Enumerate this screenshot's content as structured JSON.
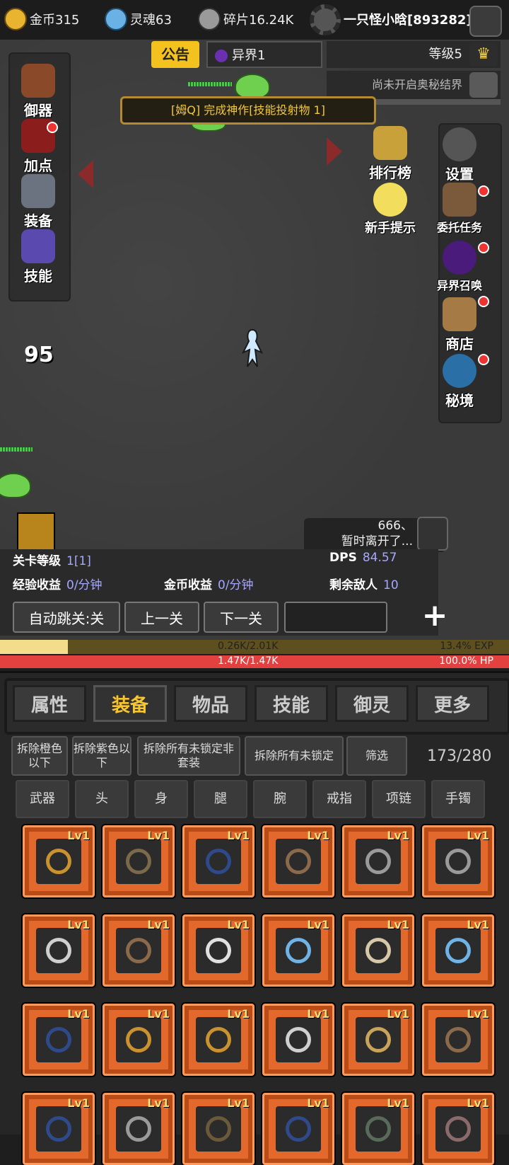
{
  "resources": {
    "gold": "金币315",
    "soul": "灵魂63",
    "fragments": "碎片16.24K"
  },
  "player": {
    "name": "一只怪小晗[893282]",
    "level": "等级5"
  },
  "header": {
    "notice_tab": "公告",
    "realm_tab": "异界1",
    "mystic_status": "尚未开启奥秘结界",
    "quest_banner": "[姆Q] 完成神作[技能投射物 1]"
  },
  "left_menu": [
    {
      "label": "御器"
    },
    {
      "label": "加点"
    },
    {
      "label": "装备"
    },
    {
      "label": "技能"
    }
  ],
  "right_menu": [
    {
      "label": "排行榜"
    },
    {
      "label": "设置"
    },
    {
      "label": "新手提示"
    },
    {
      "label": "委托任务"
    },
    {
      "label": "异界召唤"
    },
    {
      "label": "商店"
    },
    {
      "label": "秘境"
    }
  ],
  "scene": {
    "damage_number": "95",
    "chat_line1": "666、",
    "chat_line2": "暂时离开了..."
  },
  "stats": {
    "stage_level_label": "关卡等级",
    "stage_level_value": "1[1]",
    "dps_label": "DPS",
    "dps_value": "84.57",
    "exp_income_label": "经验收益",
    "exp_income_value": "0/分钟",
    "gold_income_label": "金币收益",
    "gold_income_value": "0/分钟",
    "enemies_label": "剩余敌人",
    "enemies_value": "10"
  },
  "controls": {
    "auto_skip": "自动跳关:关",
    "prev": "上一关",
    "next": "下一关",
    "plus": "+"
  },
  "bars": {
    "exp_text": "0.26K/2.01K",
    "exp_percent": "13.4%  EXP",
    "exp_fraction": 0.134,
    "hp_text": "1.47K/1.47K",
    "hp_percent": "100.0%  HP",
    "hp_fraction": 1.0
  },
  "tabs": [
    {
      "label": "属性"
    },
    {
      "label": "装备"
    },
    {
      "label": "物品"
    },
    {
      "label": "技能"
    },
    {
      "label": "御灵"
    },
    {
      "label": "更多"
    }
  ],
  "actions": {
    "remove_orange": "拆除橙色以下",
    "remove_purple": "拆除紫色以下",
    "remove_unlocked_nonset": "拆除所有未锁定非套装",
    "remove_all_unlocked": "拆除所有未锁定",
    "filter": "筛选",
    "count": "173/280"
  },
  "filters": [
    "武器",
    "头",
    "身",
    "腿",
    "腕",
    "戒指",
    "项链",
    "手镯"
  ],
  "inventory": [
    {
      "lv": "Lv1",
      "icon": "ring-icon"
    },
    {
      "lv": "Lv1",
      "icon": "necklace-icon"
    },
    {
      "lv": "Lv1",
      "icon": "boot-icon"
    },
    {
      "lv": "Lv1",
      "icon": "amulet-icon"
    },
    {
      "lv": "Lv1",
      "icon": "helmet-icon"
    },
    {
      "lv": "Lv1",
      "icon": "helmet-icon"
    },
    {
      "lv": "Lv1",
      "icon": "sword-icon"
    },
    {
      "lv": "Lv1",
      "icon": "amulet-icon"
    },
    {
      "lv": "Lv1",
      "icon": "saber-icon"
    },
    {
      "lv": "Lv1",
      "icon": "bracelet-icon"
    },
    {
      "lv": "Lv1",
      "icon": "hat-icon"
    },
    {
      "lv": "Lv1",
      "icon": "bracelet-icon"
    },
    {
      "lv": "Lv1",
      "icon": "boot-icon"
    },
    {
      "lv": "Lv1",
      "icon": "ring-icon"
    },
    {
      "lv": "Lv1",
      "icon": "ring-icon"
    },
    {
      "lv": "Lv1",
      "icon": "blade-icon"
    },
    {
      "lv": "Lv1",
      "icon": "spartan-helmet-icon"
    },
    {
      "lv": "Lv1",
      "icon": "amulet-icon"
    },
    {
      "lv": "Lv1",
      "icon": "boot-icon"
    },
    {
      "lv": "Lv1",
      "icon": "bow-icon"
    },
    {
      "lv": "Lv1",
      "icon": "crossbow-icon"
    },
    {
      "lv": "Lv1",
      "icon": "boot-icon"
    },
    {
      "lv": "Lv1",
      "icon": "twin-swords-icon"
    },
    {
      "lv": "Lv1",
      "icon": "hammer-icon"
    }
  ]
}
